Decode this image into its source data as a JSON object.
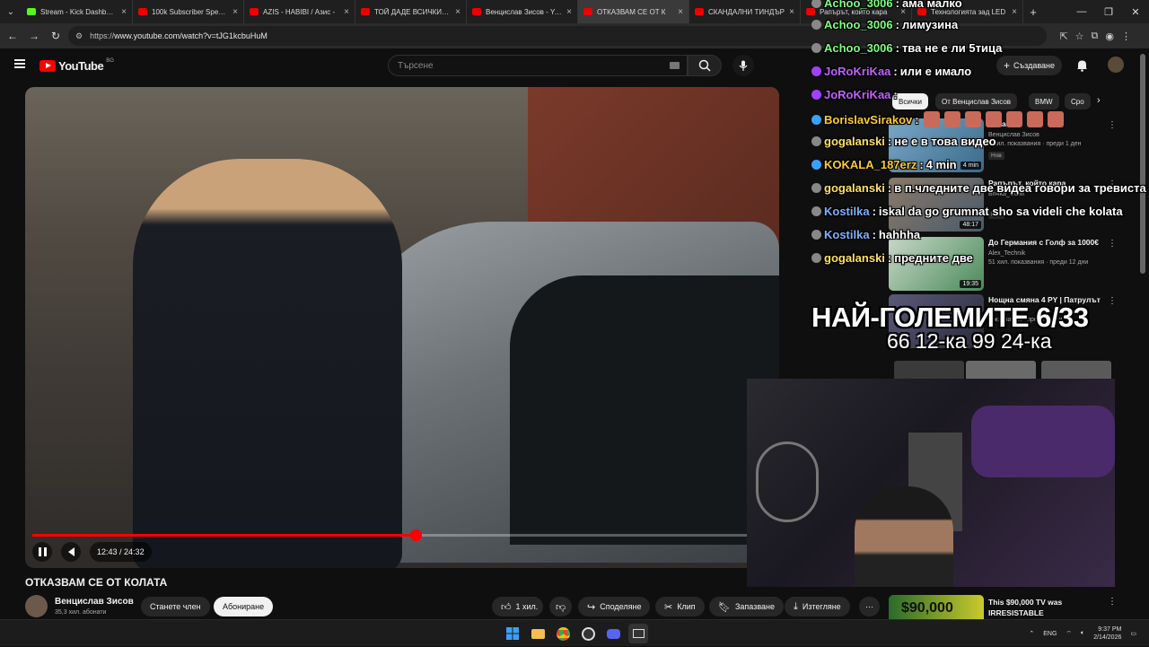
{
  "tabs": [
    {
      "title": "Stream - Kick Dashboard",
      "kind": "kick"
    },
    {
      "title": "100k Subscriber Special",
      "kind": "yt"
    },
    {
      "title": "AZIS - HABIBI / Азис -",
      "kind": "yt"
    },
    {
      "title": "ТОЙ ДАДЕ ВСИЧКИТЕ",
      "kind": "yt"
    },
    {
      "title": "Венцислав Зисов - You",
      "kind": "yt"
    },
    {
      "title": "ОТКАЗВАМ СЕ ОТ К",
      "kind": "yt",
      "active": true
    },
    {
      "title": "СКАНДАЛНИ ТИНДЪР",
      "kind": "yt"
    },
    {
      "title": "Рапърът, който кара",
      "kind": "yt"
    },
    {
      "title": "Технологията зад LED",
      "kind": "yt"
    }
  ],
  "browser": {
    "url_prefix": "https://",
    "url": "www.youtube.com/watch?v=tJG1kcbuHuM"
  },
  "header": {
    "logo_text": "YouTube",
    "logo_region": "BG",
    "search_placeholder": "Търсене",
    "create_label": "Създаване"
  },
  "player": {
    "current_time": "12:43",
    "duration": "24:32",
    "progress": 0.518
  },
  "video": {
    "title": "ОТКАЗВАМ СЕ ОТ КОЛАТА",
    "channel": "Венцислав Зисов",
    "subscribers": "35,3 хил. абонати",
    "join_label": "Станете член",
    "subscribe_label": "Абониране",
    "likes": "1 хил.",
    "share_label": "Споделяне",
    "clip_label": "Клип",
    "save_label": "Запазване",
    "download_label": "Изтегляне"
  },
  "chips": [
    {
      "label": "Всички",
      "selected": true
    },
    {
      "label": "От Венцислав Зисов"
    },
    {
      "label": "BMW"
    },
    {
      "label": "Сро"
    }
  ],
  "recommendations": [
    {
      "title": "Отказ",
      "channel": "Венцислав Зисов",
      "meta": "3 хил. показвания · преди 1 ден",
      "badge": "Нов",
      "duration": "4 min"
    },
    {
      "title": "Рапърът, който кара",
      "channel": "Bri4ka_COM",
      "meta": "",
      "badge": "Нов",
      "duration": "48:17"
    },
    {
      "title": "До Германия с Голф за 1000€",
      "channel": "Alex_Technik",
      "meta": "51 хил. показвания · преди 12 дни",
      "badge": "",
      "duration": "19:35"
    },
    {
      "title": "Нощна смяна 4 PY | Патрулът",
      "channel": "",
      "meta": "показвания · преди 6 дни",
      "badge": "",
      "duration": ""
    }
  ],
  "bottom_rec": {
    "title": "This $90,000 TV was IRRESISTABLE",
    "thumb_text": "$90,000"
  },
  "chat": [
    {
      "user": "Achoo_3006",
      "msg": "ама малко",
      "color": "#7fff7f"
    },
    {
      "user": "Achoo_3006",
      "msg": "лимузина",
      "color": "#7fff7f"
    },
    {
      "user": "Achoo_3006",
      "msg": "тва не е ли 5тица",
      "color": "#7fff7f"
    },
    {
      "user": "JoRoKriKaa",
      "msg": "или е имало",
      "color": "#c060ff"
    },
    {
      "user": "JoRoKriKaa",
      "msg": "",
      "color": "#c060ff"
    },
    {
      "user": "BorislavSirakov",
      "msg": "",
      "color": "#ffcc33"
    },
    {
      "user": "gogalanski",
      "msg": "не е в това видео",
      "color": "#ffe066"
    },
    {
      "user": "KOKALA_187erz",
      "msg": "4 min",
      "color": "#ffcc33"
    },
    {
      "user": "gogalanski",
      "msg": "в п.чледните две видеа говори за тревиста",
      "color": "#ffe066"
    },
    {
      "user": "Kostilka",
      "msg": "iskal da go grumnat sho sa videli che kolata",
      "color": "#7fb0ff"
    },
    {
      "user": "Kostilka",
      "msg": "hahhha",
      "color": "#7fb0ff"
    },
    {
      "user": "gogalanski",
      "msg": "предните две",
      "color": "#ffe066"
    }
  ],
  "overlay": {
    "headline": "НАЙ-ГОЛЕМИТЕ 6/33",
    "subline": "66 12-ка 99 24-ка"
  },
  "taskbar": {
    "lang": "ENG",
    "time": "9:37 PM",
    "date": "2/14/2026"
  },
  "colors": {
    "youtube_red": "#ff0000",
    "background": "#0f0f0f"
  }
}
